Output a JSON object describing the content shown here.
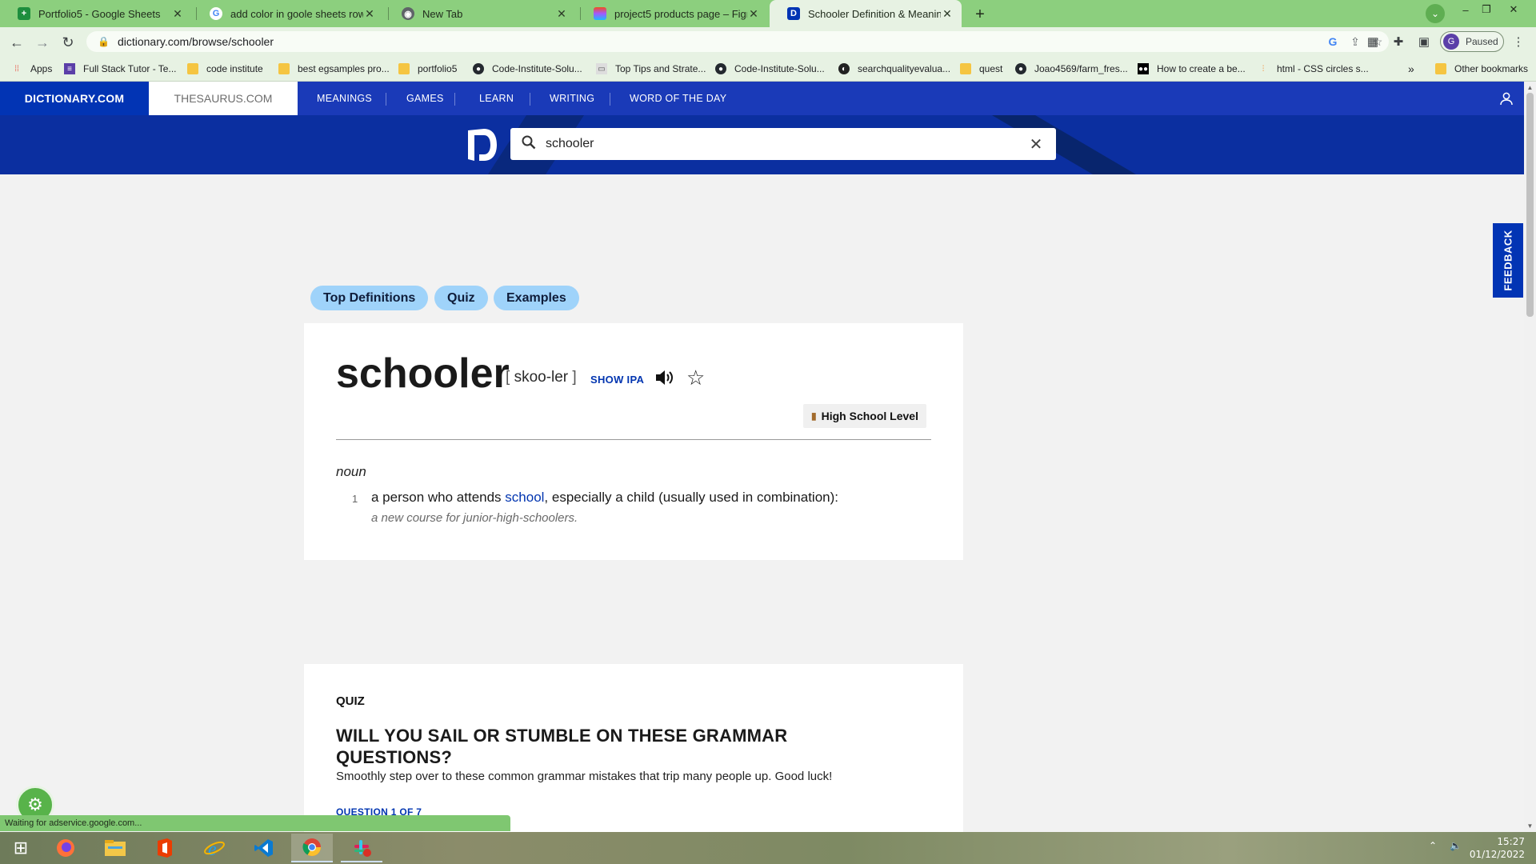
{
  "browser": {
    "tabs": [
      {
        "title": "Portfolio5 - Google Sheets",
        "icon": "sheets-icon"
      },
      {
        "title": "add color in goole sheets row - G",
        "icon": "google-icon"
      },
      {
        "title": "New Tab",
        "icon": "chrome-icon"
      },
      {
        "title": "project5 products page – Figma",
        "icon": "figma-icon"
      },
      {
        "title": "Schooler Definition & Meaning |",
        "icon": "dictionary-icon"
      }
    ],
    "url": "dictionary.com/browse/schooler",
    "profile_label": "Paused",
    "profile_initial": "G",
    "bookmarks": [
      {
        "label": "Apps",
        "icon": "apps-grid-icon"
      },
      {
        "label": "Full Stack Tutor - Te...",
        "icon": "tutor-icon"
      },
      {
        "label": "code institute",
        "icon": "folder-icon"
      },
      {
        "label": "best egsamples pro...",
        "icon": "folder-icon"
      },
      {
        "label": "portfolio5",
        "icon": "folder-icon"
      },
      {
        "label": "Code-Institute-Solu...",
        "icon": "github-icon"
      },
      {
        "label": "Top Tips and Strate...",
        "icon": "page-icon"
      },
      {
        "label": "Code-Institute-Solu...",
        "icon": "github-icon"
      },
      {
        "label": "searchqualityevalua...",
        "icon": "globe-icon"
      },
      {
        "label": "quest",
        "icon": "folder-icon"
      },
      {
        "label": "Joao4569/farm_fres...",
        "icon": "github-icon"
      },
      {
        "label": "How to create a be...",
        "icon": "medium-icon"
      },
      {
        "label": "html - CSS circles s...",
        "icon": "stackoverflow-icon"
      }
    ],
    "other_bookmarks": "Other bookmarks",
    "status_text": "Waiting for adservice.google.com..."
  },
  "site": {
    "brand": "DICTIONARY.COM",
    "thesaurus": "THESAURUS.COM",
    "nav": [
      "MEANINGS",
      "GAMES",
      "LEARN",
      "WRITING",
      "WORD OF THE DAY"
    ],
    "search_value": "schooler",
    "feedback": "FEEDBACK",
    "brand_color": "#0234b4"
  },
  "page": {
    "pills": [
      "Top Definitions",
      "Quiz",
      "Examples"
    ],
    "entry": {
      "headword": "schooler",
      "pron_open": "[",
      "pron": "skoo-ler",
      "pron_close": "]",
      "show_ipa": "SHOW IPA",
      "level": "High School Level",
      "pos": "noun",
      "def_number": "1",
      "def_before": "a person who attends ",
      "def_link": "school",
      "def_after": ", especially a child (usually used in combination):",
      "example": "a new course for junior-high-schoolers."
    },
    "quiz": {
      "eyebrow": "QUIZ",
      "title": "WILL YOU SAIL OR STUMBLE ON THESE GRAMMAR QUESTIONS?",
      "subtitle": "Smoothly step over to these common grammar mistakes that trip many people up. Good luck!",
      "question_counter": "QUESTION 1 OF 7"
    }
  },
  "taskbar": {
    "time": "15:27",
    "date": "01/12/2022",
    "apps": [
      "windows-start-icon",
      "firefox-icon",
      "file-explorer-icon",
      "office-icon",
      "internet-explorer-icon",
      "vscode-icon",
      "chrome-icon",
      "slack-icon"
    ]
  }
}
